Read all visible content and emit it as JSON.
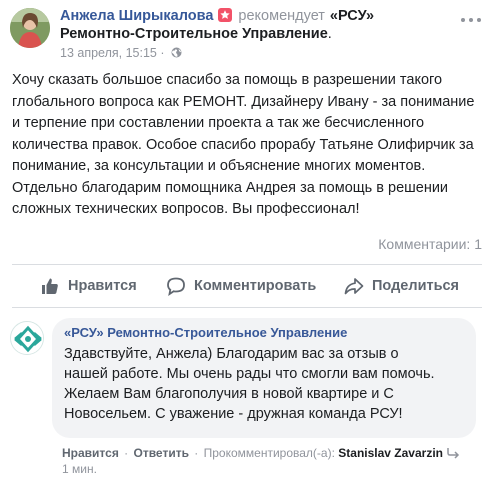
{
  "post": {
    "author": "Анжела Ширыкалова",
    "recommends": "рекомендует",
    "page_name_line1": "«РСУ»",
    "page_name_line2": "Ремонтно-Строительное Управление",
    "line2_end": ".",
    "timestamp": "13 апреля, 15:15",
    "meta_sep": " · ",
    "text": "Хочу сказать большое спасибо за помощь в  разрешении такого глобального вопроса  как РЕМОНТ. Дизайнеру Ивану - за понимание и терпение при составлении проекта а так же бесчисленного количества правок. Особое спасибо прорабу Татьяне Олифирчик за понимание, за консультации и объяснение многих моментов. Отдельно благодарим помощника Андрея за помощь в решении сложных технических вопросов. Вы профессионал!",
    "comments_count": "Комментарии: 1"
  },
  "actions": {
    "like": "Нравится",
    "comment": "Комментировать",
    "share": "Поделиться"
  },
  "comment": {
    "author": "«РСУ» Ремонтно-Строительное Управление",
    "text": "Здавствуйте, Анжела) Благодарим вас за отзыв о нашей работе. Мы очень рады что смогли вам помочь. Желаем Вам благополучия в новой квартире и С Новосельем. С уважение - дружная команда РСУ!",
    "like": "Нравится",
    "reply": "Ответить",
    "commented_by": "Прокомментировал(-а):",
    "commenter": "Stanislav Zavarzin",
    "time": "1 мин."
  },
  "colors": {
    "link": "#365899",
    "muted": "#90949c",
    "action": "#606770",
    "bubble": "#f2f3f5",
    "recommend_badge": "#f25268"
  },
  "icons": {
    "recommend": "recommend-star-icon",
    "globe": "globe-icon",
    "more": "more-options-icon",
    "like": "thumbs-up-icon",
    "comment": "comment-bubble-icon",
    "share": "share-arrow-icon",
    "reply": "reply-arrow-icon"
  }
}
